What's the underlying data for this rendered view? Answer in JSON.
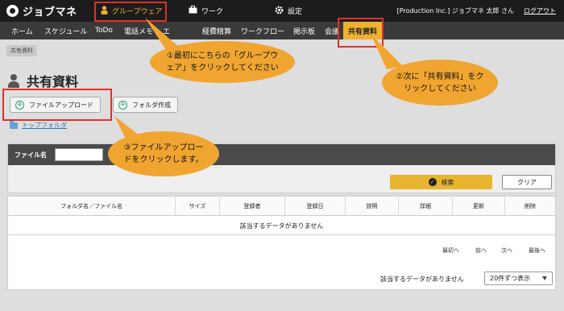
{
  "app": {
    "name": "ジョブマネ"
  },
  "topnav": [
    {
      "label": "グループウェア",
      "icon": "person-icon",
      "active": true
    },
    {
      "label": "ワーク",
      "icon": "briefcase-icon",
      "active": false
    },
    {
      "label": "設定",
      "icon": "gear-icon",
      "active": false
    }
  ],
  "user": {
    "company": "[Production Inc.] ジョブマネ 太郎 さん",
    "logout": "ログアウト"
  },
  "menu": [
    "ホーム",
    "スケジュール",
    "ToDo",
    "電話メモ",
    "エ",
    "",
    "経費精算",
    "ワークフロー",
    "掲示板",
    "会議",
    "共有資料"
  ],
  "breadcrumb": "共有資料",
  "page_title": "共有資料",
  "actions": {
    "upload": "ファイルアップロード",
    "create_folder": "フォルダ作成"
  },
  "folder_link": "トップフォルダ",
  "search": {
    "label": "ファイル名",
    "search_button": "検索",
    "clear_button": "クリア"
  },
  "table": {
    "columns": [
      "フォルダ名／ファイル名",
      "サイズ",
      "登録者",
      "登録日",
      "説明",
      "詳細",
      "更新",
      "削除"
    ],
    "empty_message": "該当するデータがありません"
  },
  "pager": {
    "first": "最初へ",
    "prev": "前へ",
    "next": "次へ",
    "last": "最後へ"
  },
  "footer": {
    "empty_message": "該当するデータがありません",
    "per_page": "20件ずつ表示"
  },
  "callouts": {
    "step1": "①最初にこちらの「グループウェア」をクリックしてください",
    "step2": "②次に「共有資料」をクリックしてください",
    "step3": "③ファイルアップロードをクリックします。"
  },
  "colors": {
    "accent": "#f0b030",
    "callout": "#f0a530",
    "highlight": "#e0302a"
  }
}
